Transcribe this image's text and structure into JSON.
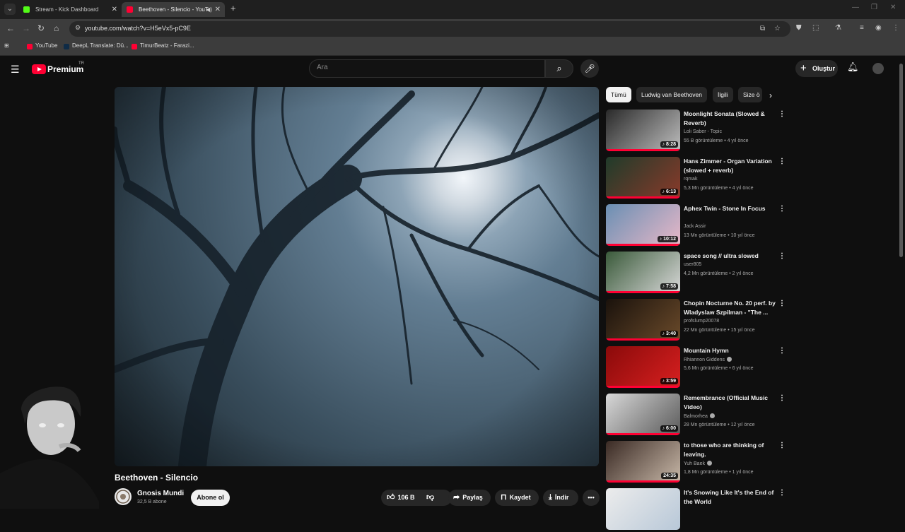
{
  "browser": {
    "tabs": [
      {
        "title": "Stream - Kick Dashboard",
        "favicon_color": "#53fc18",
        "active": false
      },
      {
        "title": "Beethoven - Silencio - YouT",
        "favicon_color": "#ff0033",
        "active": true
      }
    ],
    "url": "youtube.com/watch?v=H5eVx5-pC9E",
    "bookmarks": [
      {
        "label": "YouTube",
        "color": "#ff0033"
      },
      {
        "label": "DeepL Translate: Dü...",
        "color": "#0f2b46"
      },
      {
        "label": "TimurBeatz - Farazi...",
        "color": "#ff0033"
      }
    ]
  },
  "header": {
    "logo": "Premium",
    "logo_region": "TR",
    "search_placeholder": "Ara",
    "create_label": "Oluştur"
  },
  "video": {
    "title": "Beethoven - Silencio",
    "channel": "Gnosis Mundi",
    "subscribers": "32,5 B abone",
    "subscribe_label": "Abone ol",
    "likes": "106 B",
    "share_label": "Paylaş",
    "save_label": "Kaydet",
    "download_label": "İndir"
  },
  "chips": [
    "Tümü",
    "Ludwig van Beethoven",
    "İlgili",
    "Size ö"
  ],
  "recommendations": [
    {
      "title": "Moonlight Sonata (Slowed & Reverb)",
      "channel": "Loli Saber - Topic",
      "meta": "55 B görüntüleme • 4 yıl önce",
      "duration": "♪ 8:28",
      "verified": false,
      "colors": [
        "#2a2a2a",
        "#bdbdbd"
      ]
    },
    {
      "title": "Hans Zimmer - Organ Variation (slowed + reverb)",
      "channel": "rqmak",
      "meta": "5,3 Mn görüntüleme • 4 yıl önce",
      "duration": "♪ 6:13",
      "verified": false,
      "colors": [
        "#1f3b2a",
        "#8a3a2a"
      ]
    },
    {
      "title": "Aphex Twin - Stone In Focus",
      "channel": "Jack Assir",
      "meta": "13 Mn görüntüleme • 10 yıl önce",
      "duration": "♪ 10:12",
      "verified": false,
      "colors": [
        "#6a8fb3",
        "#e8b8c8"
      ]
    },
    {
      "title": "space song // ultra slowed",
      "channel": "user805",
      "meta": "4,2 Mn görüntüleme • 2 yıl önce",
      "duration": "♪ 7:58",
      "verified": false,
      "colors": [
        "#3a5a3a",
        "#d8d8d8"
      ]
    },
    {
      "title": "Chopin Nocturne No. 20 perf. by Wladyslaw Szpilman - \"The ...",
      "channel": "profslump20078",
      "meta": "22 Mn görüntüleme • 15 yıl önce",
      "duration": "♪ 3:40",
      "verified": false,
      "colors": [
        "#1a120c",
        "#6a4a2a"
      ]
    },
    {
      "title": "Mountain Hymn",
      "channel": "Rhiannon Giddens",
      "meta": "5,6 Mn görüntüleme • 6 yıl önce",
      "duration": "♪ 3:59",
      "verified": true,
      "colors": [
        "#8a0a0a",
        "#d82020"
      ]
    },
    {
      "title": "Remembrance (Official Music Video)",
      "channel": "Balmorhea",
      "meta": "28 Mn görüntüleme • 12 yıl önce",
      "duration": "♪ 6:00",
      "verified": true,
      "colors": [
        "#d8d8d8",
        "#5a5a5a"
      ]
    },
    {
      "title": "to those who are thinking of leaving.",
      "channel": "Yuh Baek",
      "meta": "1,8 Mn görüntüleme • 1 yıl önce",
      "duration": "24:35",
      "verified": true,
      "colors": [
        "#3a2a24",
        "#c8b8a8"
      ]
    },
    {
      "title": "It's Snowing Like It's the End of the World",
      "channel": "",
      "meta": "",
      "duration": "",
      "verified": false,
      "colors": [
        "#ececec",
        "#b8c8d8"
      ]
    }
  ]
}
